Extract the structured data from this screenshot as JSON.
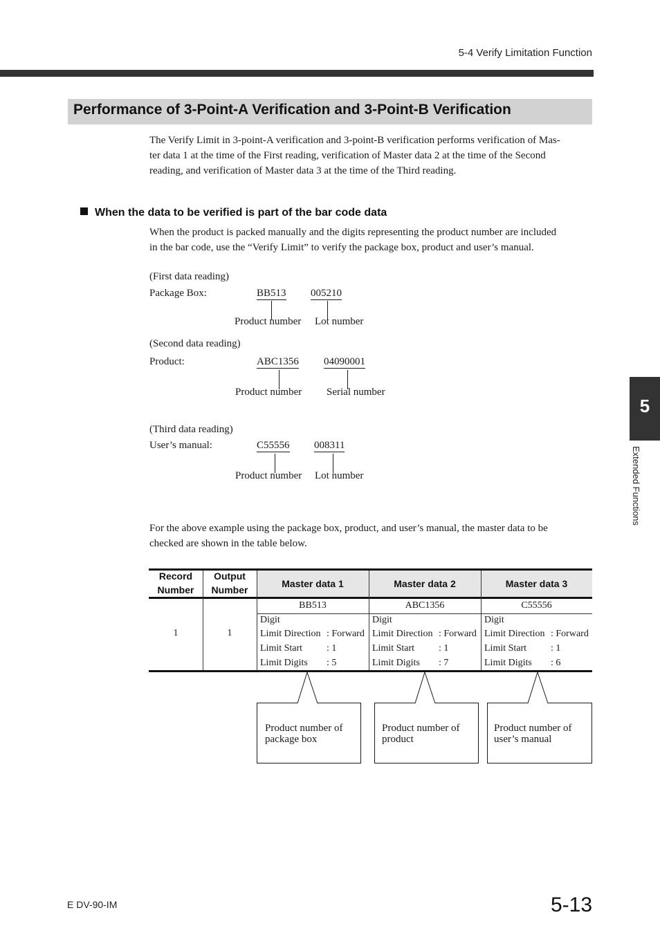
{
  "header": {
    "running_title": "5-4  Verify Limitation Function"
  },
  "section": {
    "title": "Performance of 3-Point-A Verification and 3-Point-B Verification",
    "intro_lines": [
      "The Verify Limit in 3-point-A verification and 3-point-B verification performs verification of Mas-",
      "ter data 1 at the time of the First reading, verification of Master data 2 at the time of the Second",
      "reading, and verification of Master data 3 at the time of the Third reading."
    ]
  },
  "subsection": {
    "heading": "When the data to be verified is part of the bar code data",
    "para_lines": [
      "When the product is packed manually and the digits representing the product number are included",
      "in the bar code, use the “Verify Limit” to verify the package box, product and user’s manual."
    ]
  },
  "readings": [
    {
      "caption": "(First data reading)",
      "item_label": "Package Box:",
      "code1": "BB513",
      "code2": "005210",
      "label1": "Product number",
      "label2": "Lot number"
    },
    {
      "caption": "(Second data reading)",
      "item_label": "Product:",
      "code1": "ABC1356",
      "code2": "04090001",
      "label1": "Product number",
      "label2": "Serial number"
    },
    {
      "caption": "(Third data reading)",
      "item_label": "User’s manual:",
      "code1": "C55556",
      "code2": "008311",
      "label1": "Product number",
      "label2": "Lot number"
    }
  ],
  "closing_lines": [
    "For the above example using the package box, product, and user’s manual, the master data to be",
    "checked are shown in the table below."
  ],
  "table": {
    "headers": {
      "record_line1": "Record",
      "record_line2": "Number",
      "output_line1": "Output",
      "output_line2": "Number",
      "master1": "Master data 1",
      "master2": "Master data 2",
      "master3": "Master data 3"
    },
    "row": {
      "record": "1",
      "output": "1",
      "masters": [
        {
          "value": "BB513",
          "mode": "Digit",
          "direction_label": "Limit Direction",
          "direction_value": ": Forward",
          "start_label": "Limit Start",
          "start_value": ": 1",
          "digits_label": "Limit Digits",
          "digits_value": ": 5"
        },
        {
          "value": "ABC1356",
          "mode": "Digit",
          "direction_label": "Limit Direction",
          "direction_value": ": Forward",
          "start_label": "Limit Start",
          "start_value": ": 1",
          "digits_label": "Limit Digits",
          "digits_value": ": 7"
        },
        {
          "value": "C55556",
          "mode": "Digit",
          "direction_label": "Limit Direction",
          "direction_value": ": Forward",
          "start_label": "Limit Start",
          "start_value": ": 1",
          "digits_label": "Limit Digits",
          "digits_value": ": 6"
        }
      ]
    }
  },
  "callouts": [
    {
      "line1": "Product number of",
      "line2": "package box"
    },
    {
      "line1": "Product number of",
      "line2": "product"
    },
    {
      "line1": "Product number of",
      "line2": "user’s manual"
    }
  ],
  "side_tab": {
    "chapter": "5",
    "label": "Extended Functions"
  },
  "footer": {
    "doc_code": "E DV-90-IM",
    "page_number": "5-13"
  },
  "colors": {
    "header_bar": "#333333",
    "title_band": "#d2d2d2",
    "table_header": "#e6e6e6",
    "side_tab": "#333333"
  }
}
